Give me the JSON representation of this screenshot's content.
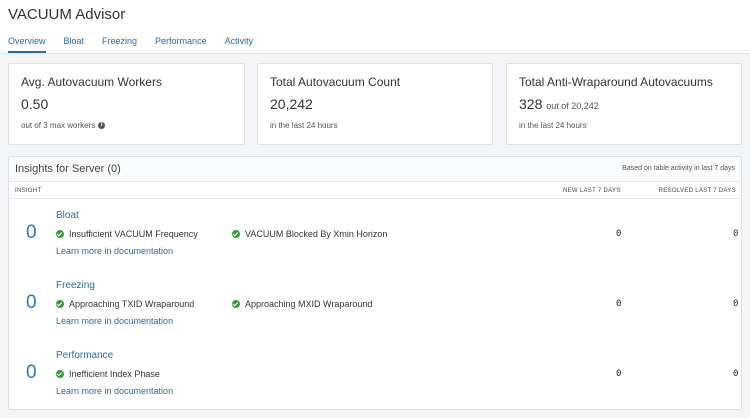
{
  "header": {
    "title": "VACUUM Advisor",
    "tabs": [
      "Overview",
      "Bloat",
      "Freezing",
      "Performance",
      "Activity"
    ]
  },
  "cards": [
    {
      "title": "Avg. Autovacuum Workers",
      "value": "0.50",
      "value_sub": "",
      "foot": "out of 3 max workers"
    },
    {
      "title": "Total Autovacuum Count",
      "value": "20,242",
      "value_sub": "",
      "foot": "in the last 24 hours"
    },
    {
      "title": "Total Anti-Wraparound Autovacuums",
      "value": "328",
      "value_sub": "out of 20,242",
      "foot": "in the last 24 hours"
    }
  ],
  "insights": {
    "title": "Insights for Server (0)",
    "note": "Based on table activity in last 7 days",
    "columns": {
      "insight": "INSIGHT",
      "new": "NEW LAST 7 DAYS",
      "resolved": "RESOLVED LAST 7 DAYS"
    },
    "learn_more": "Learn more in documentation",
    "rows": [
      {
        "count": "0",
        "name": "Bloat",
        "checks": [
          "Insufficient VACUUM Frequency",
          "VACUUM Blocked By Xmin Horizon"
        ],
        "new": "0",
        "resolved": "0"
      },
      {
        "count": "0",
        "name": "Freezing",
        "checks": [
          "Approaching TXID Wraparound",
          "Approaching MXID Wraparound"
        ],
        "new": "0",
        "resolved": "0"
      },
      {
        "count": "0",
        "name": "Performance",
        "checks": [
          "Inefficient Index Phase"
        ],
        "new": "0",
        "resolved": "0"
      }
    ]
  },
  "icons": {
    "check": "check-circle-icon",
    "info": "info-icon"
  },
  "colors": {
    "accent": "#2a6aa8",
    "success": "#3a9a3a"
  }
}
